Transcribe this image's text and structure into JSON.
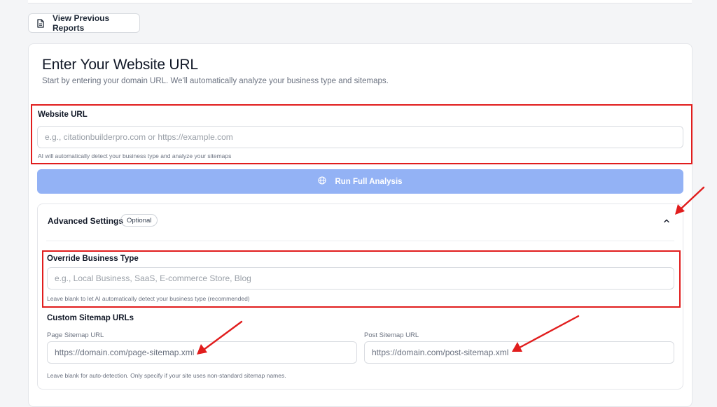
{
  "toolbar": {
    "view_previous_label": "View Previous Reports"
  },
  "form": {
    "title": "Enter Your Website URL",
    "subtitle": "Start by entering your domain URL. We'll automatically analyze your business type and sitemaps.",
    "website_url": {
      "label": "Website URL",
      "placeholder": "e.g., citationbuilderpro.com or https://example.com",
      "hint": "AI will automatically detect your business type and analyze your sitemaps"
    },
    "run_label": "Run Full Analysis",
    "advanced": {
      "title": "Advanced Settings",
      "badge": "Optional",
      "override": {
        "label": "Override Business Type",
        "placeholder": "e.g., Local Business, SaaS, E-commerce Store, Blog",
        "hint": "Leave blank to let AI automatically detect your business type (recommended)"
      },
      "custom_sitemaps_label": "Custom Sitemap URLs",
      "page_sitemap": {
        "label": "Page Sitemap URL",
        "value": "https://domain.com/page-sitemap.xml"
      },
      "post_sitemap": {
        "label": "Post Sitemap URL",
        "value": "https://domain.com/post-sitemap.xml"
      },
      "sitemap_hint": "Leave blank for auto-detection. Only specify if your site uses non-standard sitemap names."
    }
  },
  "colors": {
    "accent_button": "#93b2f5",
    "annotation_red": "#e11d1d"
  },
  "icons": {
    "view_previous": "document-icon",
    "run": "globe-icon",
    "collapse": "chevron-up-icon"
  }
}
